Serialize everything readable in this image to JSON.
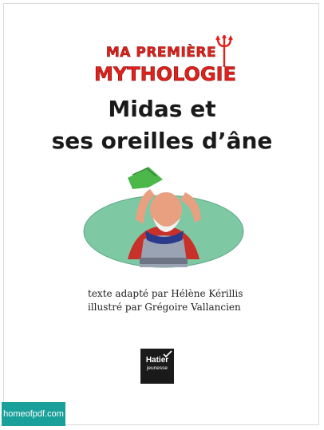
{
  "series_logo": {
    "line1": "MA PREMIÈRE",
    "line2": "MYTHOLOGIE",
    "colors": {
      "fill": "#e2211c",
      "outline": "#7a1410"
    }
  },
  "title": {
    "line1": "Midas et",
    "line2": "ses oreilles d’âne"
  },
  "illustration": {
    "icon": "king-midas-donkey-ears-illustration",
    "colors": {
      "oval": "#7ec8a4",
      "ears": "#4cb84a",
      "skin": "#e8a080",
      "cloak": "#c8302a",
      "collar": "#2a3b8c"
    }
  },
  "credits": {
    "author_line": "texte adapté par Hélène Kérillis",
    "illustrator_line": "illustré par Grégoire Vallancien"
  },
  "publisher": {
    "name": "Hatier",
    "sub": "jeunesse",
    "color": "#1a1a1a"
  },
  "watermark": {
    "text": "homeofpdf.com",
    "color": "#1aa09a"
  }
}
